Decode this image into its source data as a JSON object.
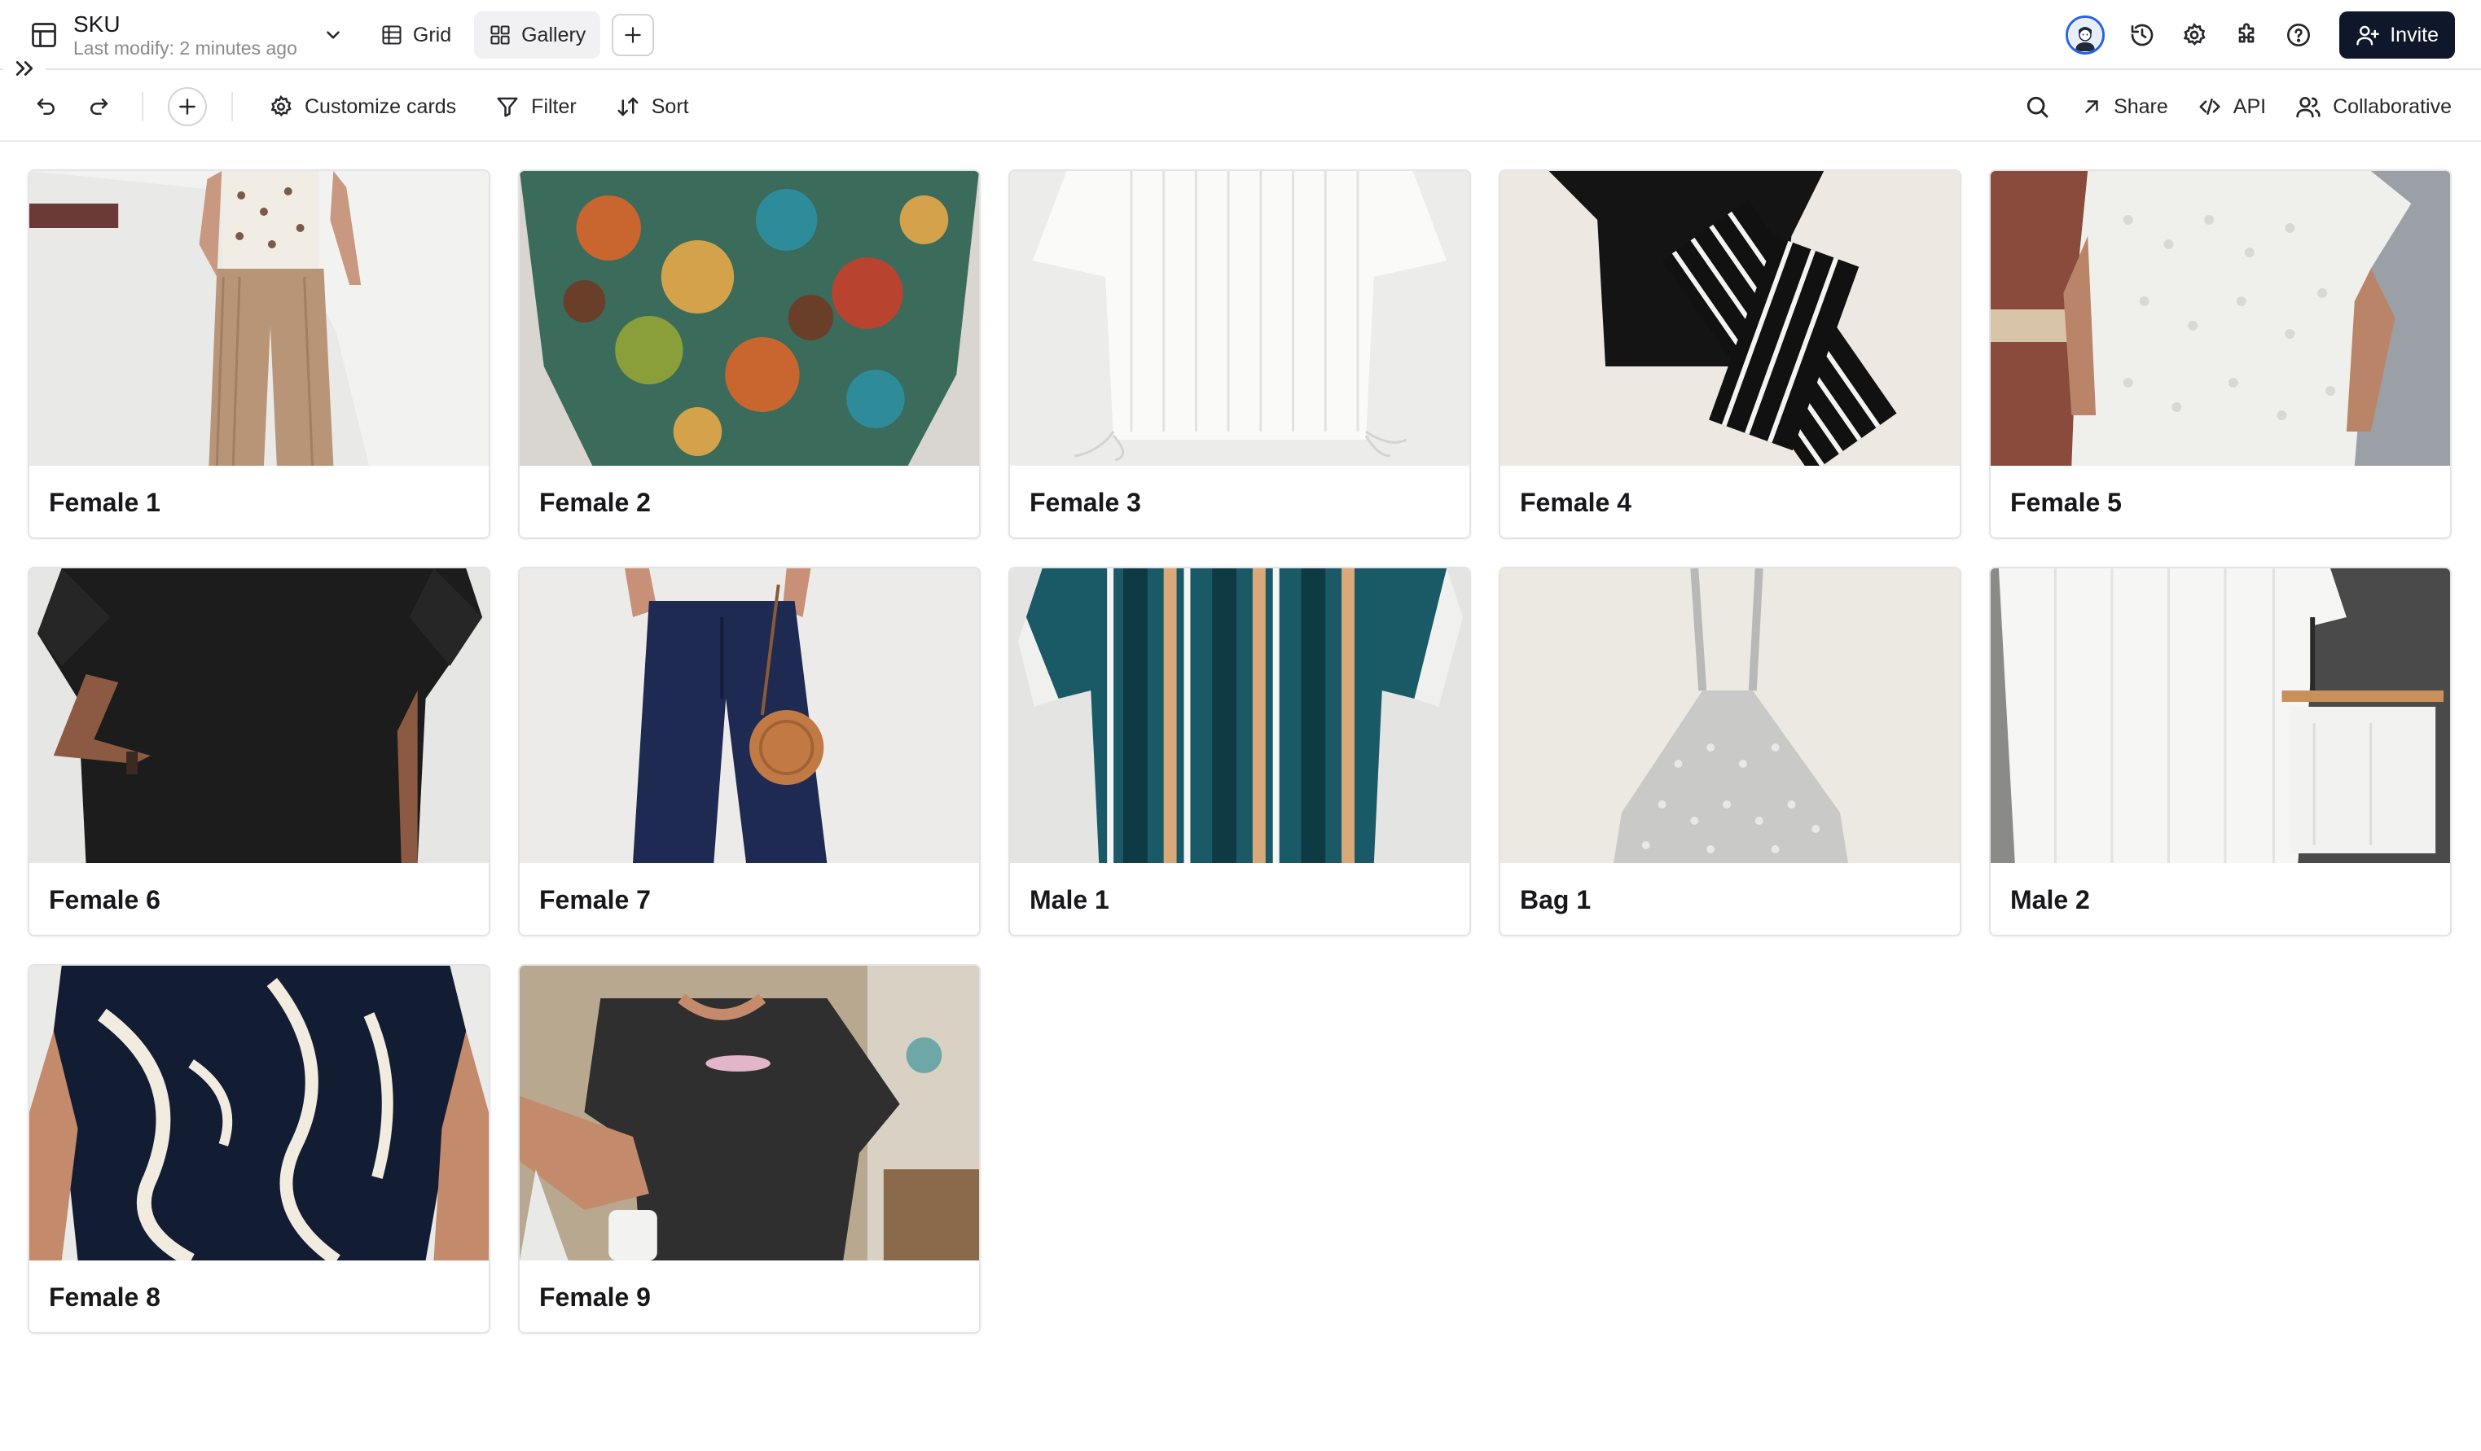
{
  "header": {
    "table_name": "SKU",
    "last_modified": "Last modify: 2 minutes ago",
    "views": [
      {
        "label": "Grid",
        "active": false
      },
      {
        "label": "Gallery",
        "active": true
      }
    ],
    "invite_label": "Invite"
  },
  "toolbar": {
    "customize_label": "Customize cards",
    "filter_label": "Filter",
    "sort_label": "Sort",
    "share_label": "Share",
    "api_label": "API",
    "collaborative_label": "Collaborative"
  },
  "gallery": {
    "cards": [
      {
        "title": "Female 1",
        "image": "beige-wide-pants-patterned-top"
      },
      {
        "title": "Female 2",
        "image": "paisley-print-blouse"
      },
      {
        "title": "Female 3",
        "image": "white-ribbed-crop-top"
      },
      {
        "title": "Female 4",
        "image": "black-top-striped-pants"
      },
      {
        "title": "Female 5",
        "image": "white-eyelet-dress"
      },
      {
        "title": "Female 6",
        "image": "black-ruffle-sleeve-top"
      },
      {
        "title": "Female 7",
        "image": "navy-wide-pants-rattan-bag"
      },
      {
        "title": "Male 1",
        "image": "teal-striped-shirt"
      },
      {
        "title": "Bag 1",
        "image": "silver-rhinestone-bag"
      },
      {
        "title": "Male 2",
        "image": "white-shirt-shorts-set"
      },
      {
        "title": "Female 8",
        "image": "navy-abstract-print-top"
      },
      {
        "title": "Female 9",
        "image": "dark-oversized-tee-california"
      }
    ]
  },
  "colors": {
    "accent": "#2563eb",
    "invite_bg": "#0f172a",
    "border": "#e4e4e7"
  }
}
